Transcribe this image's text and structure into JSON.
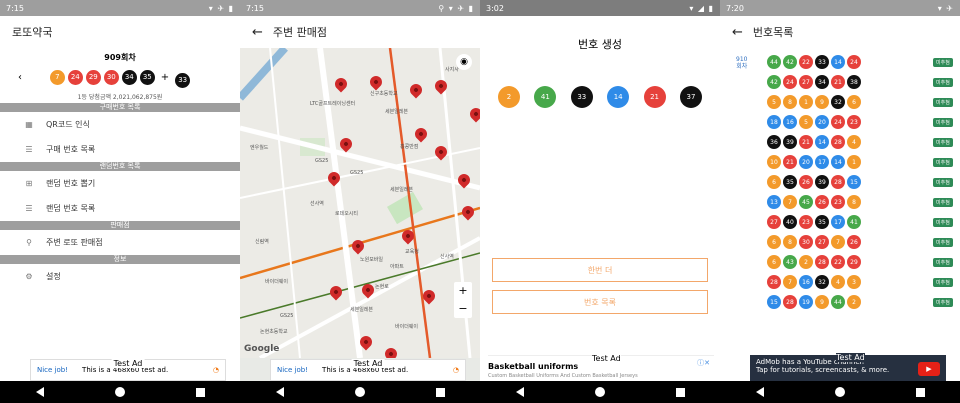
{
  "panel1": {
    "status": {
      "time": "7:15"
    },
    "title": "로또약국",
    "round": "909회차",
    "balls": [
      {
        "n": "7",
        "c": "b-y"
      },
      {
        "n": "24",
        "c": "b-r"
      },
      {
        "n": "29",
        "c": "b-r"
      },
      {
        "n": "30",
        "c": "b-r"
      },
      {
        "n": "34",
        "c": "b-b"
      },
      {
        "n": "35",
        "c": "b-b"
      }
    ],
    "plus": "+",
    "bonus": {
      "n": "33",
      "c": "b-b"
    },
    "prize": "1등 당첨금액 2,021,062,875원",
    "sections": {
      "purchase": "구매번호 목록",
      "random": "랜덤번호 목록",
      "shop": "판매점",
      "info": "정보"
    },
    "menu": {
      "qr": "QR코드 인식",
      "purchase_list": "구매 번호 목록",
      "random_pick": "랜덤 번호 뽑기",
      "random_list": "랜덤 번호 목록",
      "nearby": "주변 로또 판매점",
      "settings": "설정"
    },
    "ad": {
      "tag": "Test Ad",
      "cta": "Nice job!",
      "text": "This is a 468x60 test ad."
    }
  },
  "panel2": {
    "status": {
      "time": "7:15"
    },
    "title": "주변 판매점",
    "pois": [
      "사지사",
      "신구초등학교",
      "LTC골프트레이닝센터",
      "세븐일레븐",
      "GS25",
      "홍콩반점",
      "엔우월드",
      "GS25",
      "세븐일레븐",
      "선사역",
      "로데오시티",
      "신림역",
      "노원모바일",
      "바이더웨이",
      "GS25",
      "아파트",
      "논현로",
      "세븐일레븐",
      "바이더웨이",
      "논현초등학교",
      "교육청",
      "신사역"
    ],
    "google": "Google",
    "zoom_in": "+",
    "zoom_out": "−",
    "ad": {
      "tag": "Test Ad",
      "cta": "Nice job!",
      "text": "This is a 468x60 test ad."
    }
  },
  "panel3": {
    "status": {
      "time": "3:02"
    },
    "title": "번호 생성",
    "balls": [
      {
        "n": "2",
        "c": "b-y"
      },
      {
        "n": "41",
        "c": "b-g"
      },
      {
        "n": "33",
        "c": "b-b"
      },
      {
        "n": "14",
        "c": "b-bl"
      },
      {
        "n": "21",
        "c": "b-r"
      },
      {
        "n": "37",
        "c": "b-b"
      }
    ],
    "again": "한번 더",
    "list": "번호 목록",
    "ad": {
      "tag": "Test Ad",
      "title": "Basketball uniforms",
      "sub": "Custom Basketball Uniforms And Custom Basketball Jerseys"
    }
  },
  "panel4": {
    "status": {
      "time": "7:20"
    },
    "title": "번호목록",
    "round": "910",
    "round_unit": "회차",
    "badge": "미추첨",
    "rows": [
      [
        [
          "44",
          "b-g"
        ],
        [
          "42",
          "b-g"
        ],
        [
          "22",
          "b-r"
        ],
        [
          "33",
          "b-b"
        ],
        [
          "14",
          "b-bl"
        ],
        [
          "24",
          "b-r"
        ]
      ],
      [
        [
          "42",
          "b-g"
        ],
        [
          "24",
          "b-r"
        ],
        [
          "27",
          "b-r"
        ],
        [
          "34",
          "b-b"
        ],
        [
          "21",
          "b-r"
        ],
        [
          "38",
          "b-b"
        ]
      ],
      [
        [
          "5",
          "b-y"
        ],
        [
          "8",
          "b-y"
        ],
        [
          "1",
          "b-y"
        ],
        [
          "9",
          "b-y"
        ],
        [
          "32",
          "b-b"
        ],
        [
          "6",
          "b-y"
        ]
      ],
      [
        [
          "18",
          "b-bl"
        ],
        [
          "16",
          "b-bl"
        ],
        [
          "5",
          "b-y"
        ],
        [
          "20",
          "b-bl"
        ],
        [
          "24",
          "b-r"
        ],
        [
          "23",
          "b-r"
        ]
      ],
      [
        [
          "36",
          "b-b"
        ],
        [
          "39",
          "b-b"
        ],
        [
          "21",
          "b-r"
        ],
        [
          "14",
          "b-bl"
        ],
        [
          "28",
          "b-r"
        ],
        [
          "4",
          "b-y"
        ]
      ],
      [
        [
          "10",
          "b-y"
        ],
        [
          "21",
          "b-r"
        ],
        [
          "20",
          "b-bl"
        ],
        [
          "17",
          "b-bl"
        ],
        [
          "14",
          "b-bl"
        ],
        [
          "1",
          "b-y"
        ]
      ],
      [
        [
          "6",
          "b-y"
        ],
        [
          "35",
          "b-b"
        ],
        [
          "26",
          "b-r"
        ],
        [
          "39",
          "b-b"
        ],
        [
          "28",
          "b-r"
        ],
        [
          "15",
          "b-bl"
        ]
      ],
      [
        [
          "13",
          "b-bl"
        ],
        [
          "7",
          "b-y"
        ],
        [
          "45",
          "b-g"
        ],
        [
          "26",
          "b-r"
        ],
        [
          "23",
          "b-r"
        ],
        [
          "8",
          "b-y"
        ]
      ],
      [
        [
          "27",
          "b-r"
        ],
        [
          "40",
          "b-b"
        ],
        [
          "23",
          "b-r"
        ],
        [
          "35",
          "b-b"
        ],
        [
          "17",
          "b-bl"
        ],
        [
          "41",
          "b-g"
        ]
      ],
      [
        [
          "6",
          "b-y"
        ],
        [
          "8",
          "b-y"
        ],
        [
          "30",
          "b-r"
        ],
        [
          "27",
          "b-r"
        ],
        [
          "7",
          "b-y"
        ],
        [
          "26",
          "b-r"
        ]
      ],
      [
        [
          "6",
          "b-y"
        ],
        [
          "43",
          "b-g"
        ],
        [
          "2",
          "b-y"
        ],
        [
          "28",
          "b-r"
        ],
        [
          "22",
          "b-r"
        ],
        [
          "29",
          "b-r"
        ]
      ],
      [
        [
          "28",
          "b-r"
        ],
        [
          "7",
          "b-y"
        ],
        [
          "16",
          "b-bl"
        ],
        [
          "32",
          "b-b"
        ],
        [
          "4",
          "b-y"
        ],
        [
          "3",
          "b-y"
        ]
      ],
      [
        [
          "15",
          "b-bl"
        ],
        [
          "28",
          "b-r"
        ],
        [
          "19",
          "b-bl"
        ],
        [
          "9",
          "b-y"
        ],
        [
          "44",
          "b-g"
        ],
        [
          "2",
          "b-y"
        ]
      ]
    ],
    "ad": {
      "tag": "Test Ad",
      "line1": "AdMob has a YouTube channel!",
      "line2": "Tap for tutorials, screencasts, & more."
    }
  }
}
